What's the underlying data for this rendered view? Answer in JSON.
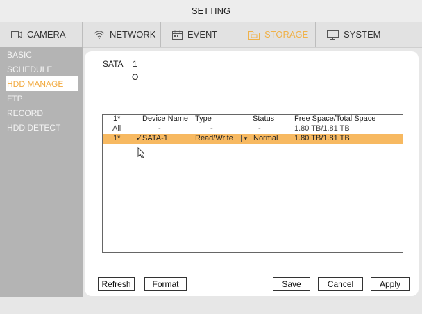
{
  "window": {
    "title": "SETTING"
  },
  "tabs": [
    {
      "label": "CAMERA",
      "icon": "camera-icon"
    },
    {
      "label": "NETWORK",
      "icon": "wifi-icon"
    },
    {
      "label": "EVENT",
      "icon": "calendar-icon"
    },
    {
      "label": "STORAGE",
      "icon": "folder-icon",
      "active": true
    },
    {
      "label": "SYSTEM",
      "icon": "monitor-icon"
    }
  ],
  "sidebar": {
    "items": [
      {
        "label": "BASIC"
      },
      {
        "label": "SCHEDULE"
      },
      {
        "label": "HDD MANAGE",
        "selected": true
      },
      {
        "label": "FTP"
      },
      {
        "label": "RECORD"
      },
      {
        "label": "HDD DETECT"
      }
    ]
  },
  "sata": {
    "label": "SATA",
    "number": "1",
    "status_symbol": "O"
  },
  "table": {
    "columns": [
      "1*",
      "Device Name",
      "Type",
      "Status",
      "Free Space/Total Space"
    ],
    "rows": [
      {
        "index": "All",
        "device": "-",
        "type": "-",
        "status": "-",
        "space": "1.80 TB/1.81 TB"
      },
      {
        "index": "1*",
        "check": "✓",
        "device": "SATA-1",
        "type": "Read/Write",
        "status": "Normal",
        "space": "1.80 TB/1.81 TB",
        "highlighted": true
      }
    ]
  },
  "buttons": {
    "refresh": "Refresh",
    "format": "Format",
    "save": "Save",
    "cancel": "Cancel",
    "apply": "Apply"
  },
  "colors": {
    "accent": "#f2a93d",
    "row_highlight": "#f7b961",
    "sidebar": "#b4b4b4"
  }
}
